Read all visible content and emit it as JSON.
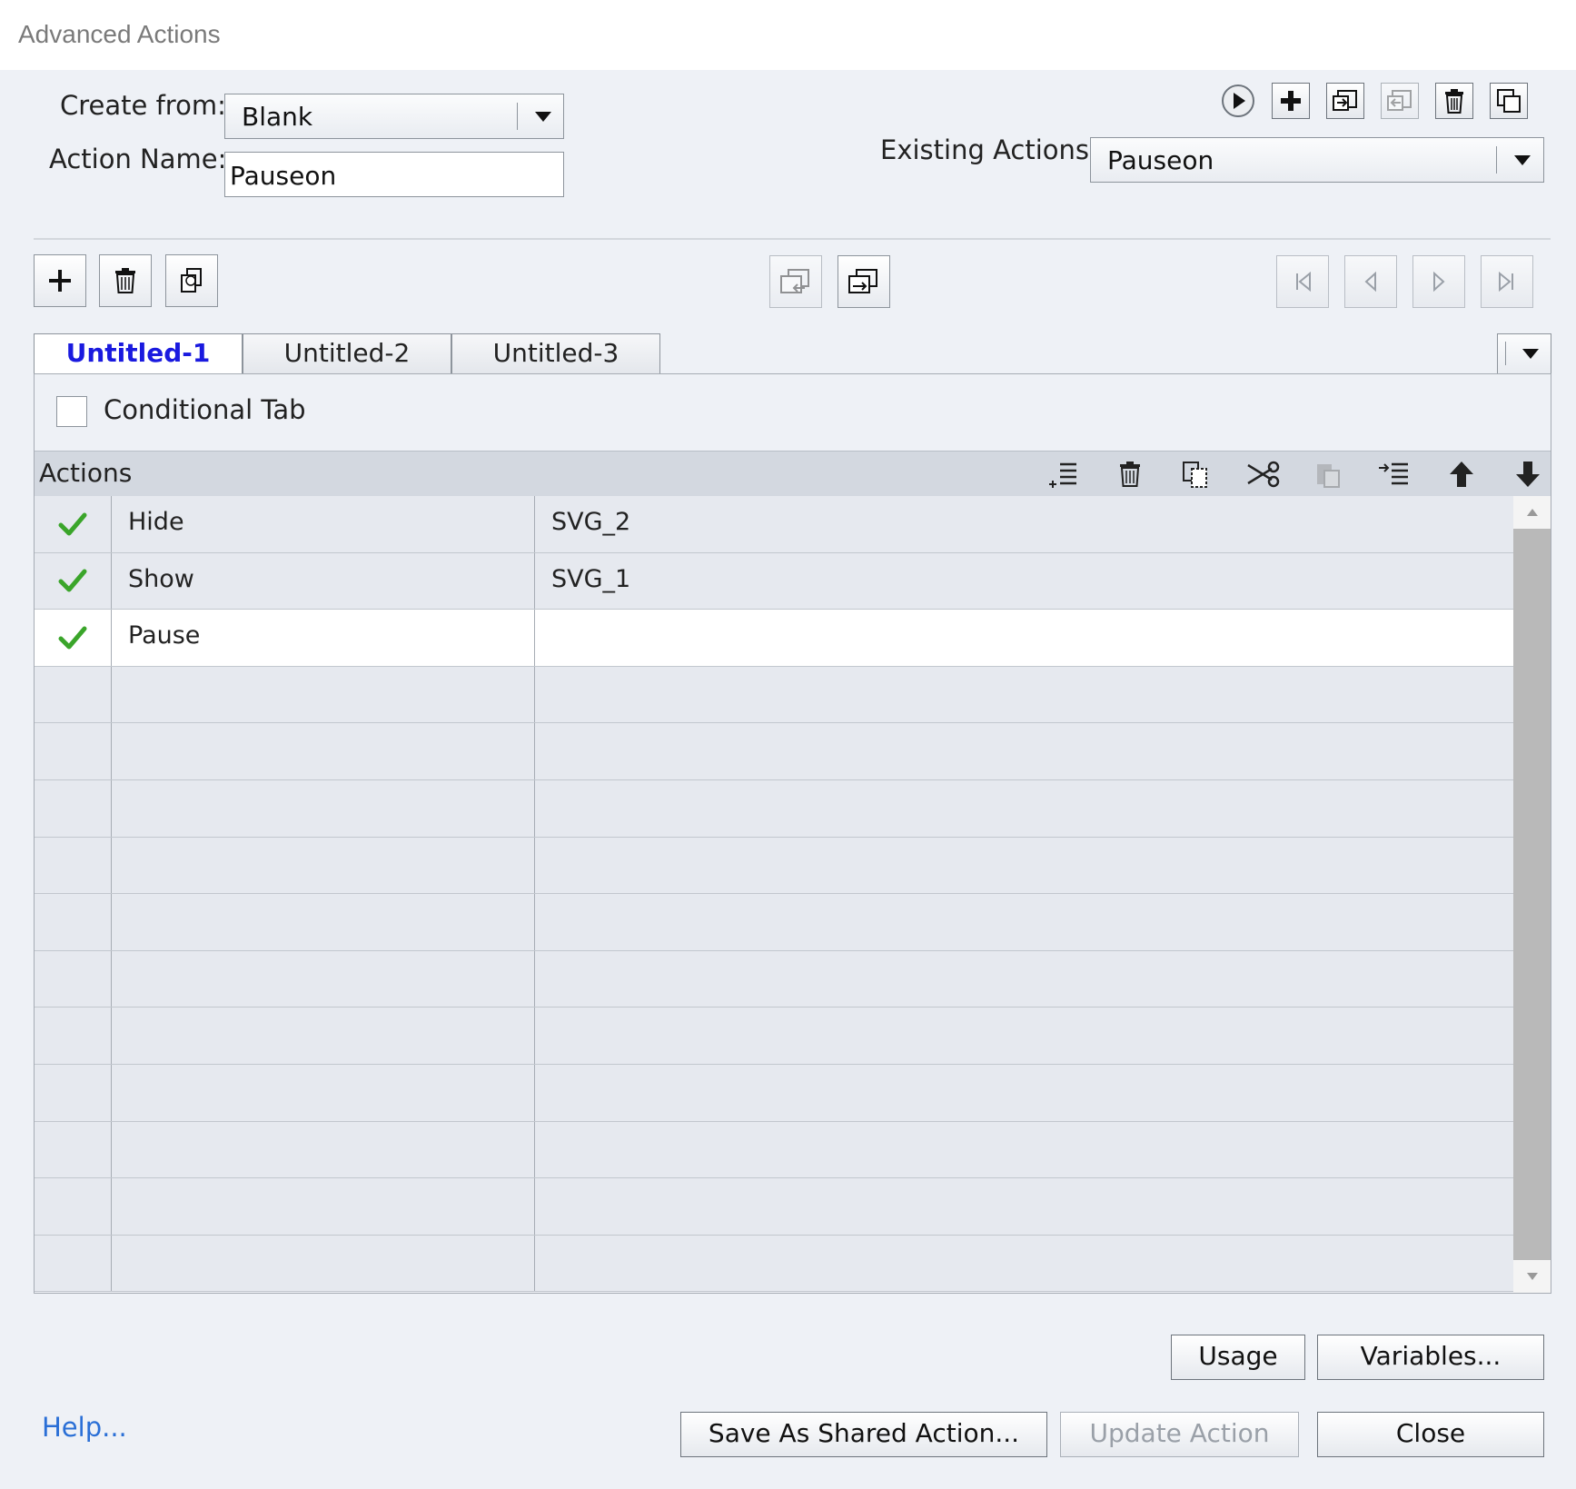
{
  "window": {
    "title": "Advanced Actions"
  },
  "header": {
    "create_from_label": "Create from:",
    "create_from_value": "Blank",
    "action_name_label": "Action Name:",
    "action_name_value": "Pauseon",
    "existing_actions_label": "Existing Actions:",
    "existing_actions_value": "Pauseon",
    "top_icons": [
      "preview-icon",
      "add-icon",
      "import-icon",
      "export-icon",
      "delete-icon",
      "duplicate-icon"
    ]
  },
  "toolbar": {
    "left_icons": [
      "add-decision-icon",
      "delete-decision-icon",
      "duplicate-decision-icon"
    ],
    "middle_icons": [
      "move-left-icon",
      "move-right-icon"
    ],
    "nav_icons": [
      "first-icon",
      "previous-icon",
      "next-icon",
      "last-icon"
    ]
  },
  "tabs": [
    {
      "label": "Untitled-1",
      "active": true
    },
    {
      "label": "Untitled-2",
      "active": false
    },
    {
      "label": "Untitled-3",
      "active": false
    }
  ],
  "conditional": {
    "label": "Conditional Tab",
    "checked": false
  },
  "actions_table": {
    "header": "Actions",
    "toolbar_icons": [
      "insert-row-icon",
      "delete-row-icon",
      "copy-icon",
      "cut-icon",
      "paste-icon",
      "paste-insert-icon",
      "move-up-icon",
      "move-down-icon"
    ],
    "rows": [
      {
        "valid": true,
        "action": "Hide",
        "target": "SVG_2",
        "selected": false
      },
      {
        "valid": true,
        "action": "Show",
        "target": "SVG_1",
        "selected": false
      },
      {
        "valid": true,
        "action": "Pause",
        "target": "",
        "selected": true
      },
      {
        "valid": false,
        "action": "",
        "target": ""
      },
      {
        "valid": false,
        "action": "",
        "target": ""
      },
      {
        "valid": false,
        "action": "",
        "target": ""
      },
      {
        "valid": false,
        "action": "",
        "target": ""
      },
      {
        "valid": false,
        "action": "",
        "target": ""
      },
      {
        "valid": false,
        "action": "",
        "target": ""
      },
      {
        "valid": false,
        "action": "",
        "target": ""
      },
      {
        "valid": false,
        "action": "",
        "target": ""
      },
      {
        "valid": false,
        "action": "",
        "target": ""
      },
      {
        "valid": false,
        "action": "",
        "target": ""
      },
      {
        "valid": false,
        "action": "",
        "target": ""
      }
    ]
  },
  "buttons": {
    "usage": "Usage",
    "variables": "Variables...",
    "save_shared": "Save As Shared Action...",
    "update": "Update Action",
    "close": "Close",
    "help": "Help..."
  },
  "colors": {
    "accent_blue": "#1a1adf",
    "link_blue": "#2a6fd6",
    "check_green": "#3aa52a",
    "panel_bg": "#eef1f6"
  }
}
